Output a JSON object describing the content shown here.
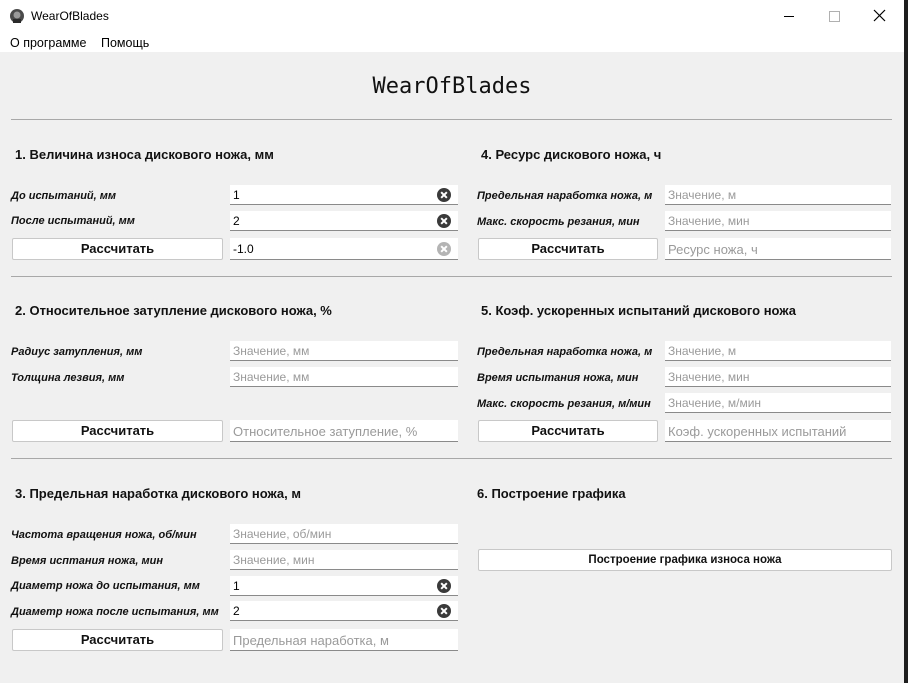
{
  "window": {
    "title": "WearOfBlades"
  },
  "menu": {
    "about": "О программе",
    "help": "Помощь"
  },
  "heading": "WearOfBlades",
  "sections": {
    "s1": {
      "title": "1. Величина износа дискового ножа, мм",
      "label_before": "До испытаний, мм",
      "value_before": "1",
      "label_after": "После испытаний, мм",
      "value_after": "2",
      "button": "Рассчитать",
      "result": "-1.0"
    },
    "s2": {
      "title": "2. Относительное затупление дискового ножа, %",
      "label_radius": "Радиус затупления, мм",
      "ph_radius": "Значение, мм",
      "label_thickness": "Толщина лезвия, мм",
      "ph_thickness": "Значение, мм",
      "button": "Рассчитать",
      "result_ph": "Относительное затупление, %"
    },
    "s3": {
      "title": "3. Предельная наработка дискового ножа, м",
      "label_freq": "Частота вращения ножа, об/мин",
      "ph_freq": "Значение, об/мин",
      "label_time": "Время исптания ножа, мин",
      "ph_time": "Значение, мин",
      "label_d_before": "Диаметр ножа до испытания, мм",
      "value_d_before": "1",
      "label_d_after": "Диаметр ножа после испытания, мм",
      "value_d_after": "2",
      "button": "Рассчитать",
      "result_ph": "Предельная наработка, м"
    },
    "s4": {
      "title": "4. Ресурс дискового ножа, ч",
      "label_limit": "Предельная наработка ножа, м",
      "ph_limit": "Значение, м",
      "label_speed": "Макс. скорость резания, мин",
      "ph_speed": "Значение, мин",
      "button": "Рассчитать",
      "result_ph": "Ресурс ножа, ч"
    },
    "s5": {
      "title": "5. Коэф. ускоренных испытаний дискового ножа",
      "label_limit": "Предельная наработка ножа, м",
      "ph_limit": "Значение, м",
      "label_time": "Время испытания ножа, мин",
      "ph_time": "Значение, мин",
      "label_speed": "Макс. скорость резания, м/мин",
      "ph_speed": "Значение, м/мин",
      "button": "Рассчитать",
      "result_ph": "Коэф. ускоренных испытаний"
    },
    "s6": {
      "title": "6. Построение графика",
      "button": "Построение графика износа ножа"
    }
  }
}
